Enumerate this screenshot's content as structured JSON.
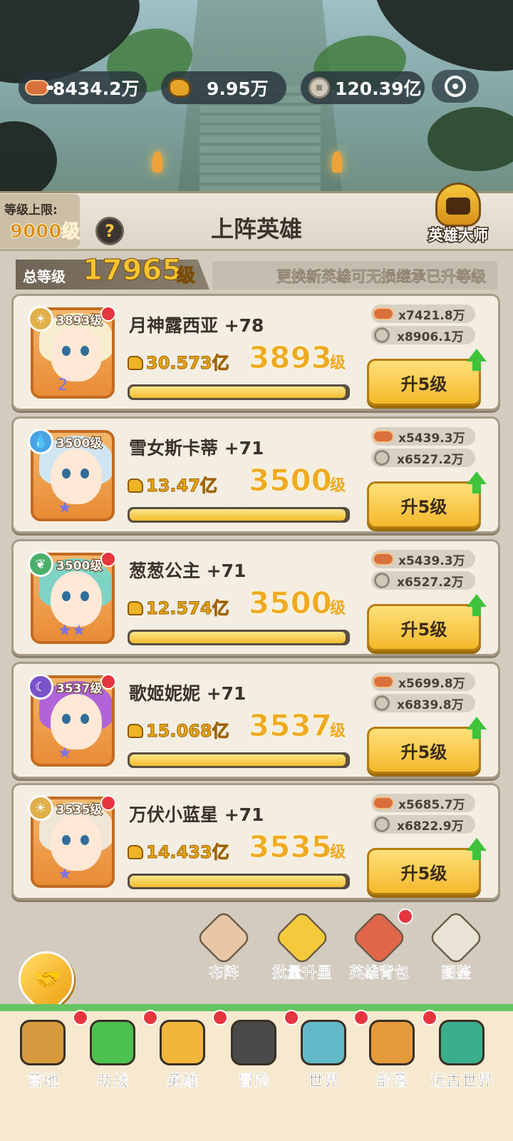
{
  "resources": [
    {
      "icon": "meat-icon",
      "value": "8434.2万"
    },
    {
      "icon": "ore-icon",
      "value": "9.95万"
    },
    {
      "icon": "coin-icon",
      "value": "120.39亿"
    }
  ],
  "header": {
    "cap_label": "等级上限:",
    "cap_value": "9000级",
    "help_glyph": "?",
    "title": "上阵英雄",
    "master_label": "英雄大师"
  },
  "summary": {
    "total_label": "总等级",
    "total_value": "17965",
    "total_unit": "级",
    "hint": "更换新英雄可无损继承已升等级"
  },
  "heroes": [
    {
      "badge": "3893级",
      "name": "月神露西亚 +78",
      "power": "30.573亿",
      "level": "3893",
      "unit": "级",
      "meat": "x7421.8万",
      "coin": "x8906.1万",
      "button": "升5级",
      "progress": 0.99,
      "dot": true,
      "star_label": "2",
      "element": "sun",
      "hair": "#f6eecf",
      "colors": "#f2c14e"
    },
    {
      "badge": "3500级",
      "name": "雪女斯卡蒂 +71",
      "power": "13.47亿",
      "level": "3500",
      "unit": "级",
      "meat": "x5439.3万",
      "coin": "x6527.2万",
      "button": "升5级",
      "progress": 0.99,
      "dot": false,
      "star_label": "★",
      "element": "water",
      "hair": "#cfe6f2",
      "colors": "#4aa3e3"
    },
    {
      "badge": "3500级",
      "name": "葱葱公主 +71",
      "power": "12.574亿",
      "level": "3500",
      "unit": "级",
      "meat": "x5439.3万",
      "coin": "x6527.2万",
      "button": "升5级",
      "progress": 0.99,
      "dot": true,
      "star_label": "★★",
      "element": "leaf",
      "hair": "#7fd3c4",
      "colors": "#4ab06b"
    },
    {
      "badge": "3537级",
      "name": "歌姬妮妮 +71",
      "power": "15.068亿",
      "level": "3537",
      "unit": "级",
      "meat": "x5699.8万",
      "coin": "x6839.8万",
      "button": "升5级",
      "progress": 0.99,
      "dot": true,
      "star_label": "★",
      "element": "moon",
      "hair": "#b064d8",
      "colors": "#7b52c8"
    },
    {
      "badge": "3535级",
      "name": "万伏小蓝星 +71",
      "power": "14.433亿",
      "level": "3535",
      "unit": "级",
      "meat": "x5685.7万",
      "coin": "x6822.9万",
      "button": "升5级",
      "progress": 0.99,
      "dot": true,
      "star_label": "★",
      "element": "sun",
      "hair": "#efe6d6",
      "colors": "#f2c14e"
    }
  ],
  "actions": [
    {
      "label": "布阵",
      "icon": "formation-icon",
      "color": "#e7c7a5",
      "dot": false
    },
    {
      "label": "批量升星",
      "icon": "batch-star-icon",
      "color": "#f5c93c",
      "dot": false
    },
    {
      "label": "英雄背包",
      "icon": "hero-bag-icon",
      "color": "#e0664a",
      "dot": true
    },
    {
      "label": "图鉴",
      "icon": "codex-icon",
      "color": "#e9e3d5",
      "dot": false
    }
  ],
  "nav": [
    {
      "label": "营地",
      "icon": "camp-icon",
      "color": "#d79a3e"
    },
    {
      "label": "助战",
      "icon": "assist-icon",
      "color": "#4cc150"
    },
    {
      "label": "英雄",
      "icon": "hero-icon",
      "color": "#f1b73a"
    },
    {
      "label": "冒险",
      "icon": "adventure-icon",
      "color": "#4a4a4a"
    },
    {
      "label": "世界",
      "icon": "world-icon",
      "color": "#63b9c8"
    },
    {
      "label": "部落",
      "icon": "tribe-icon",
      "color": "#e59a3c"
    },
    {
      "label": "远古世界",
      "icon": "ancient-world-icon",
      "color": "#3dae8c"
    }
  ],
  "colors": {
    "accent": "#f2bd2d",
    "dot": "#e5363f",
    "progress": "#f2bd2d",
    "upgrade_arrow": "#3ec33b"
  }
}
